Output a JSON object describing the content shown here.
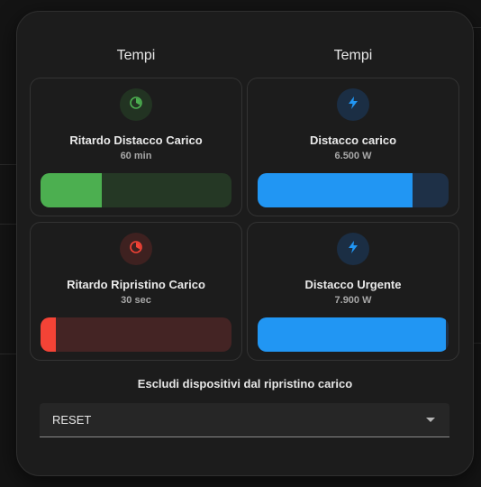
{
  "dialog": {
    "left_header": "Tempi",
    "right_header": "Tempi"
  },
  "cards": [
    {
      "title": "Ritardo Distacco Carico",
      "value": "60 min",
      "icon": "timer-icon",
      "accent": "#4caf50",
      "track": "#253825",
      "circle_bg": "#223322",
      "fill_fraction": 0.32
    },
    {
      "title": "Distacco carico",
      "value": "6.500 W",
      "icon": "flash-icon",
      "accent": "#2196f3",
      "track": "#1e3047",
      "circle_bg": "#1b2e44",
      "fill_fraction": 0.81
    },
    {
      "title": "Ritardo Ripristino Carico",
      "value": "30 sec",
      "icon": "timer-icon",
      "accent": "#f44336",
      "track": "#442424",
      "circle_bg": "#3e2120",
      "fill_fraction": 0.08
    },
    {
      "title": "Distacco Urgente",
      "value": "7.900 W",
      "icon": "flash-icon",
      "accent": "#2196f3",
      "track": "#1e3047",
      "circle_bg": "#1b2e44",
      "fill_fraction": 0.985
    }
  ],
  "exclude": {
    "label": "Escludi dispositivi dal ripristino carico",
    "selected": "RESET"
  }
}
